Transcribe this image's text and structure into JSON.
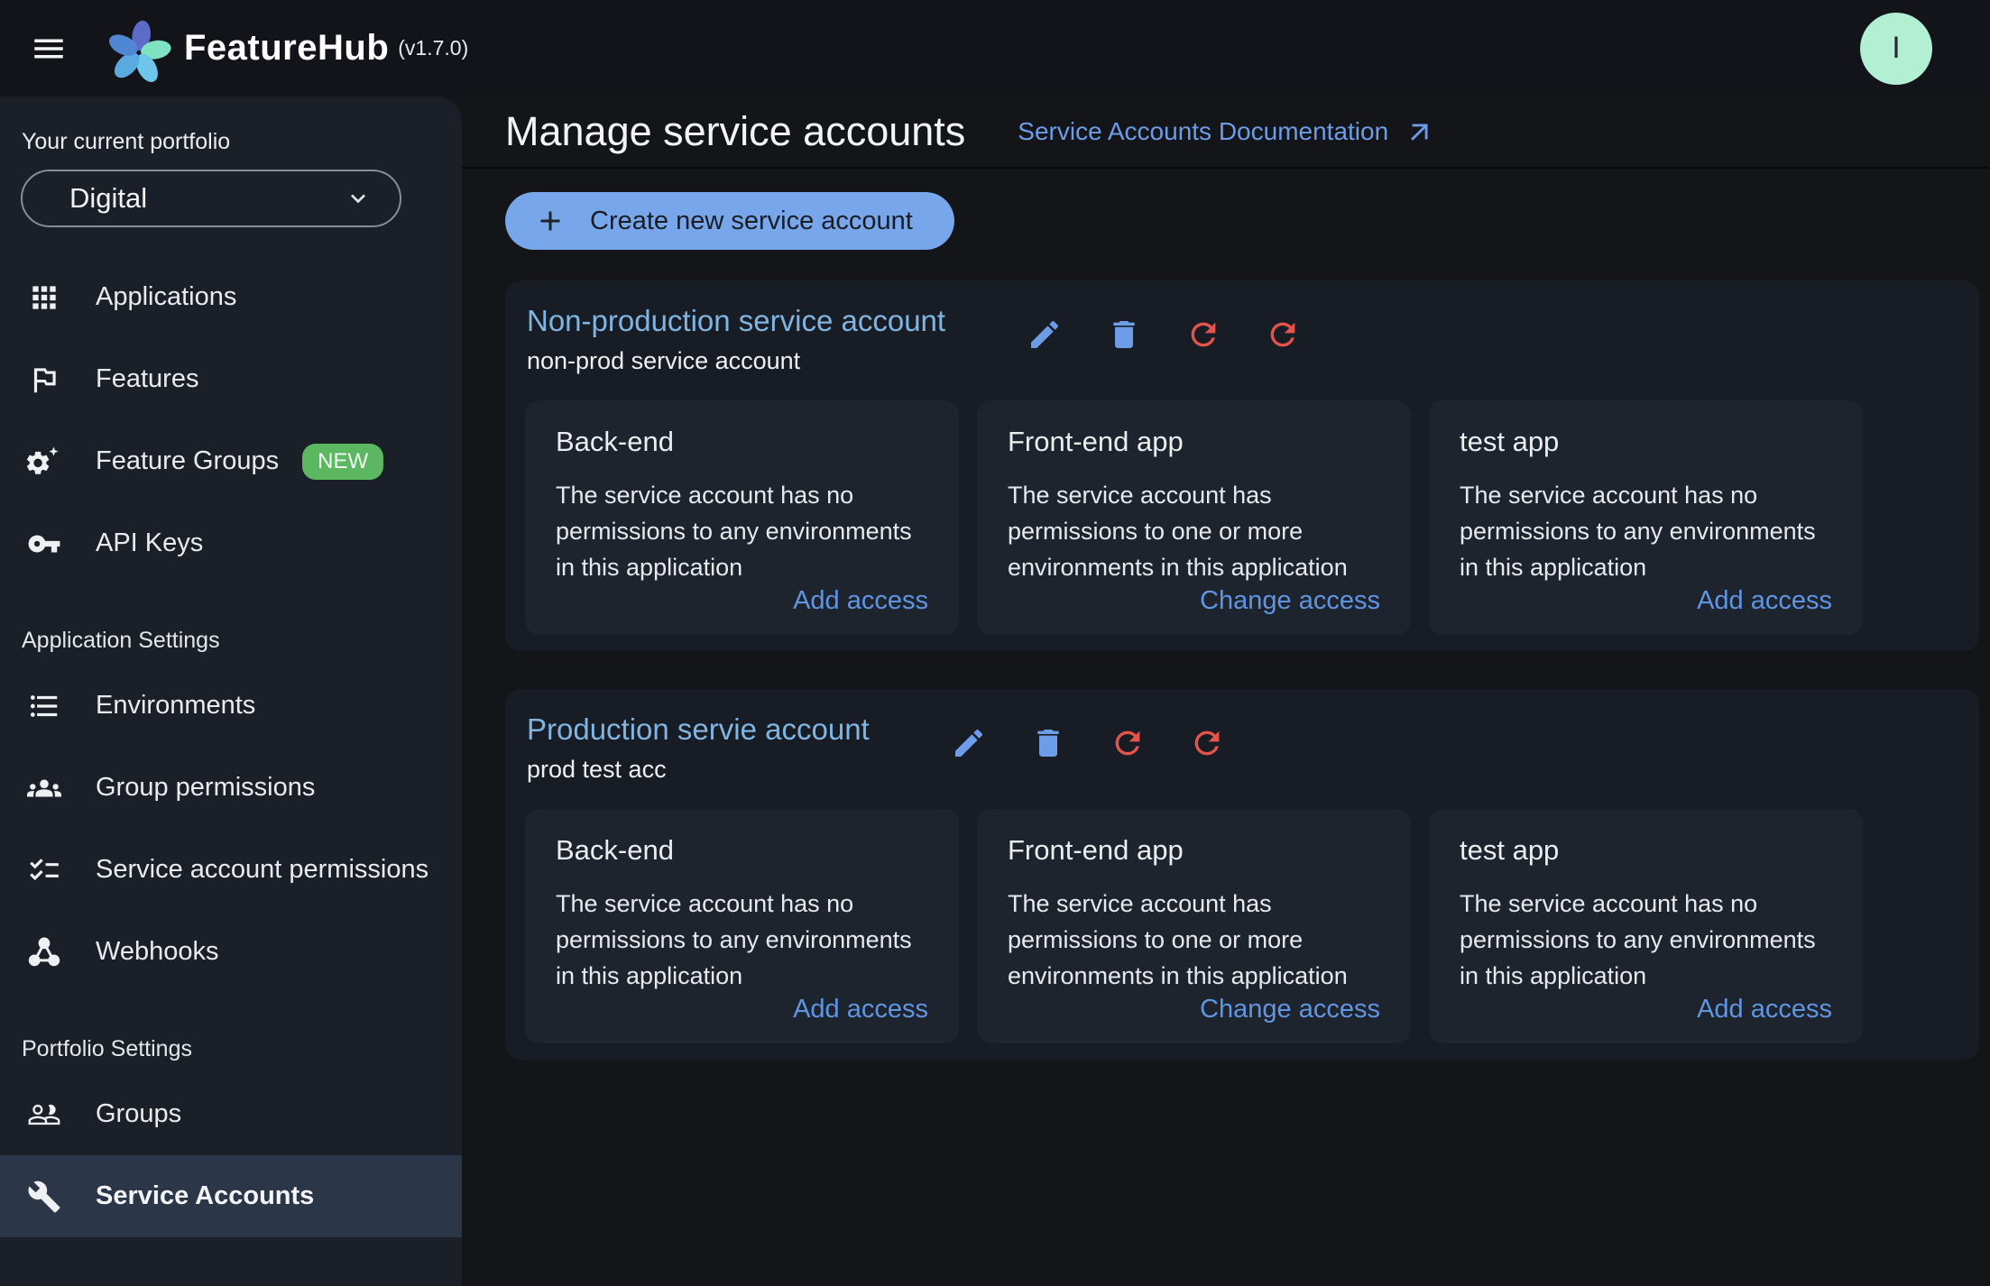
{
  "theme": {
    "accent_blue": "#78a6ea",
    "link_blue": "#6d9ce8",
    "title_blue": "#7fb5e2",
    "danger_red": "#e5544b",
    "badge_green": "#5cb860",
    "avatar_mint": "#b3efd2"
  },
  "topbar": {
    "app_name": "FeatureHub",
    "version": "(v1.7.0)",
    "avatar_initial": "I"
  },
  "sidebar": {
    "portfolio_label": "Your current portfolio",
    "portfolio_value": "Digital",
    "section_headers": {
      "application": "Application Settings",
      "portfolio": "Portfolio Settings"
    },
    "items": [
      {
        "label": "Applications",
        "icon": "apps-grid-icon"
      },
      {
        "label": "Features",
        "icon": "flag-icon"
      },
      {
        "label": "Feature Groups",
        "icon": "gear-sparkle-icon",
        "badge": "NEW"
      },
      {
        "label": "API Keys",
        "icon": "key-icon"
      },
      {
        "label": "Environments",
        "icon": "list-icon"
      },
      {
        "label": "Group permissions",
        "icon": "people-group-icon"
      },
      {
        "label": "Service account permissions",
        "icon": "checklist-icon"
      },
      {
        "label": "Webhooks",
        "icon": "webhook-icon"
      },
      {
        "label": "Groups",
        "icon": "people-outline-icon"
      },
      {
        "label": "Service Accounts",
        "icon": "wrench-icon",
        "selected": true
      }
    ]
  },
  "main": {
    "title": "Manage service accounts",
    "doc_link": "Service Accounts Documentation",
    "create_button": "Create new service account",
    "accounts": [
      {
        "title": "Non-production service account",
        "description": "non-prod service account",
        "apps": [
          {
            "name": "Back-end",
            "text": "The service account has no permissions to any environments in this application",
            "action": "Add access"
          },
          {
            "name": "Front-end app",
            "text": "The service account has permissions to one or more environments in this application",
            "action": "Change access"
          },
          {
            "name": "test app",
            "text": "The service account has no permissions to any environments in this application",
            "action": "Add access"
          }
        ]
      },
      {
        "title": "Production servie account",
        "description": "prod test acc",
        "apps": [
          {
            "name": "Back-end",
            "text": "The service account has no permissions to any environments in this application",
            "action": "Add access"
          },
          {
            "name": "Front-end app",
            "text": "The service account has permissions to one or more environments in this application",
            "action": "Change access"
          },
          {
            "name": "test app",
            "text": "The service account has no permissions to any environments in this application",
            "action": "Add access"
          }
        ]
      }
    ]
  }
}
